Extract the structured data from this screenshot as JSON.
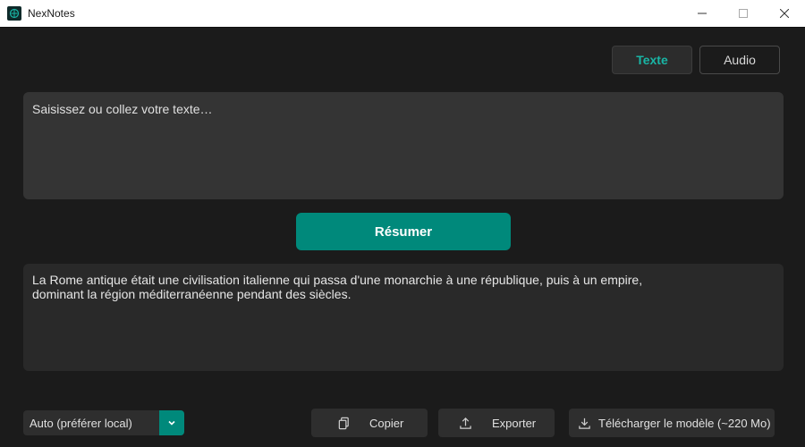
{
  "window": {
    "title": "NexNotes"
  },
  "mode_tabs": [
    {
      "label": "Texte",
      "active": true
    },
    {
      "label": "Audio",
      "active": false
    }
  ],
  "input": {
    "placeholder": "Saisissez ou collez votre texte…",
    "value": ""
  },
  "summarize_button": {
    "label": "Résumer"
  },
  "output": {
    "lines": [
      "La Rome antique était une civilisation italienne qui passa d'une monarchie à une république, puis à un empire,",
      "dominant la région méditerranéenne pendant des siècles."
    ]
  },
  "model_select": {
    "selected": "Auto (préférer local)"
  },
  "actions": {
    "copy_label": "Copier",
    "export_label": "Exporter",
    "download_label": "Télécharger le modèle (~220 Mo)"
  },
  "colors": {
    "accent": "#00897b",
    "accent_text": "#19b5a5",
    "background": "#1b1b1b"
  }
}
